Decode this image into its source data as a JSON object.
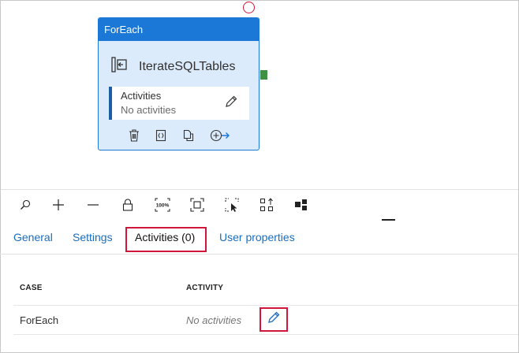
{
  "node": {
    "header": "ForEach",
    "name": "IterateSQLTables",
    "activities_label": "Activities",
    "activities_value": "No activities",
    "accent_color": "#1b78d7"
  },
  "toolbar": {
    "zoom_percent_label": "100%",
    "icons": [
      "search-icon",
      "zoom-in-icon",
      "zoom-out-icon",
      "lock-icon",
      "zoom-100-icon",
      "fit-to-screen-icon",
      "select-pointer-icon",
      "auto-align-icon",
      "layout-icon"
    ]
  },
  "tabs": [
    {
      "label": "General"
    },
    {
      "label": "Settings"
    },
    {
      "label": "Activities (0)",
      "active": true
    },
    {
      "label": "User properties"
    }
  ],
  "table": {
    "headers": [
      "CASE",
      "ACTIVITY"
    ],
    "rows": [
      {
        "case": "ForEach",
        "activity": "No activities"
      }
    ]
  },
  "colors": {
    "highlight": "#d0163a",
    "link": "#1b6dbd",
    "port": "#3f9144"
  }
}
